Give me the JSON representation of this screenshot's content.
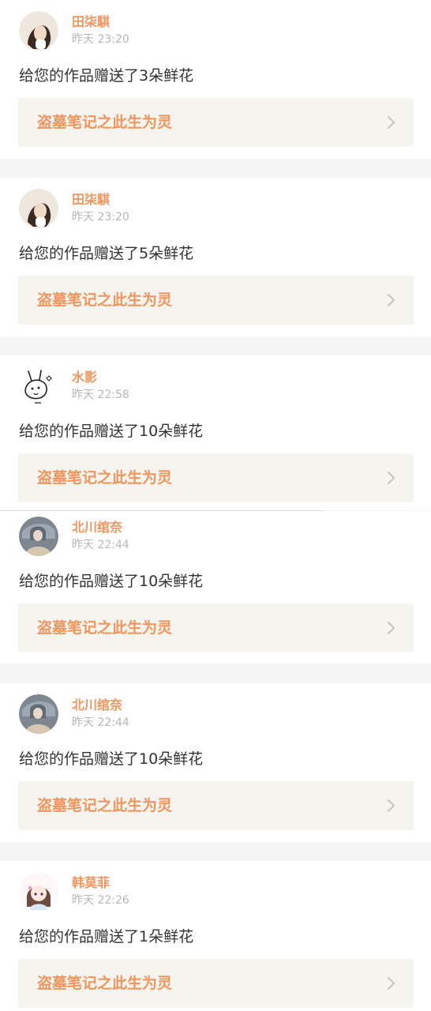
{
  "notifications": [
    {
      "user": "田柒騏",
      "time": "昨天 23:20",
      "message": "给您的作品赠送了3朵鲜花",
      "work_title": "盗墓笔记之此生为灵",
      "avatar_icon": "avatar-photo-icon",
      "avatar_colors": [
        "#efe7de",
        "#3a2a22"
      ]
    },
    {
      "user": "田柒騏",
      "time": "昨天 23:20",
      "message": "给您的作品赠送了5朵鲜花",
      "work_title": "盗墓笔记之此生为灵",
      "avatar_icon": "avatar-photo-icon",
      "avatar_colors": [
        "#efe7de",
        "#3a2a22"
      ]
    },
    {
      "user": "水影",
      "time": "昨天 22:58",
      "message": "给您的作品赠送了10朵鲜花",
      "work_title": "盗墓笔记之此生为灵",
      "avatar_icon": "avatar-doodle-icon",
      "avatar_colors": [
        "#ffffff",
        "#222222"
      ]
    },
    {
      "user": "北川绾奈",
      "time": "昨天 22:44",
      "message": "给您的作品赠送了10朵鲜花",
      "work_title": "盗墓笔记之此生为灵",
      "avatar_icon": "avatar-photo-icon",
      "avatar_colors": [
        "#7e8790",
        "#d6c7b0"
      ]
    },
    {
      "user": "北川绾奈",
      "time": "昨天 22:44",
      "message": "给您的作品赠送了10朵鲜花",
      "work_title": "盗墓笔记之此生为灵",
      "avatar_icon": "avatar-photo-icon",
      "avatar_colors": [
        "#7e8790",
        "#d6c7b0"
      ]
    },
    {
      "user": "韩莫菲",
      "time": "昨天 22:26",
      "message": "给您的作品赠送了1朵鲜花",
      "work_title": "盗墓笔记之此生为灵",
      "avatar_icon": "avatar-anime-girl-icon",
      "avatar_colors": [
        "#fff6f8",
        "#6b4b42"
      ]
    }
  ],
  "colors": {
    "accent": "#f0955d",
    "text_primary": "#333333",
    "text_secondary": "#b7b7b7",
    "card_background": "#ffffff",
    "page_background": "#f5f5f5",
    "link_background": "#f5f4ee",
    "chevron": "#c8c8c8"
  },
  "icons": {
    "link_arrow": "chevron-right-icon"
  }
}
